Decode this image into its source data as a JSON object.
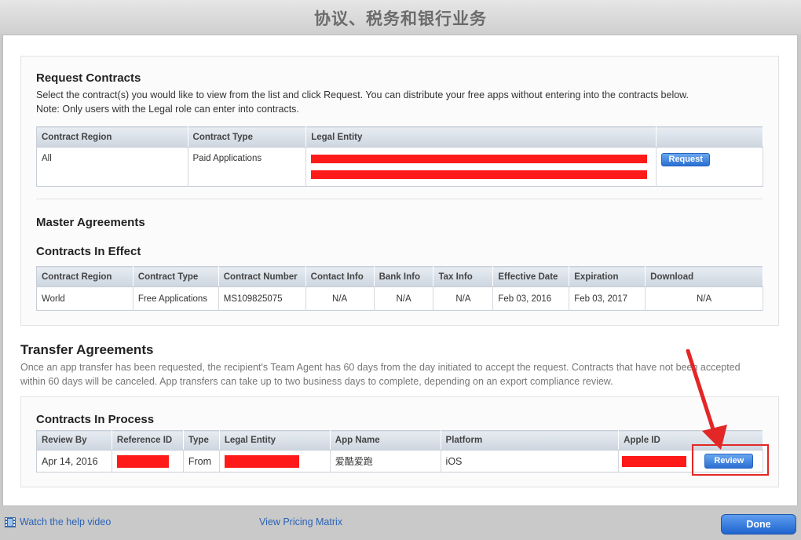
{
  "window": {
    "title": "协议、税务和银行业务"
  },
  "request_contracts": {
    "heading": "Request Contracts",
    "description": "Select the contract(s) you would like to view from the list and click Request. You can distribute your free apps without entering into the contracts below.",
    "note": "Note: Only users with the Legal role can enter into contracts.",
    "columns": [
      "Contract Region",
      "Contract Type",
      "Legal Entity"
    ],
    "row": {
      "region": "All",
      "type": "Paid Applications",
      "action_label": "Request"
    }
  },
  "master_agreements": {
    "heading": "Master Agreements"
  },
  "contracts_in_effect": {
    "heading": "Contracts In Effect",
    "columns": [
      "Contract Region",
      "Contract Type",
      "Contract Number",
      "Contact Info",
      "Bank Info",
      "Tax Info",
      "Effective Date",
      "Expiration",
      "Download"
    ],
    "row": {
      "region": "World",
      "type": "Free Applications",
      "number": "MS109825075",
      "contact": "N/A",
      "bank": "N/A",
      "tax": "N/A",
      "effective": "Feb 03, 2016",
      "expiration": "Feb 03, 2017",
      "download": "N/A"
    }
  },
  "transfer_agreements": {
    "heading": "Transfer Agreements",
    "description": "Once an app transfer has been requested, the recipient's Team Agent has 60 days from the day initiated to accept the request. Contracts that have not been accepted within 60 days will be canceled. App transfers can take up to two business days to complete, depending on an export compliance review."
  },
  "contracts_in_process": {
    "heading": "Contracts In Process",
    "columns": [
      "Review By",
      "Reference ID",
      "Type",
      "Legal Entity",
      "App Name",
      "Platform",
      "Apple ID"
    ],
    "row": {
      "review_by": "Apr 14, 2016",
      "type": "From",
      "app_name": "爱酷爱跑",
      "platform": "iOS",
      "action_label": "Review"
    }
  },
  "footer": {
    "help_video": "Watch the help video",
    "pricing": "View Pricing Matrix",
    "done": "Done"
  },
  "colors": {
    "redaction": "#ff1a1a",
    "accent_blue": "#2a6fd3",
    "annotation_red": "#e32626"
  },
  "icons": {
    "help": "film-icon",
    "annotation": "red-arrow-icon"
  }
}
